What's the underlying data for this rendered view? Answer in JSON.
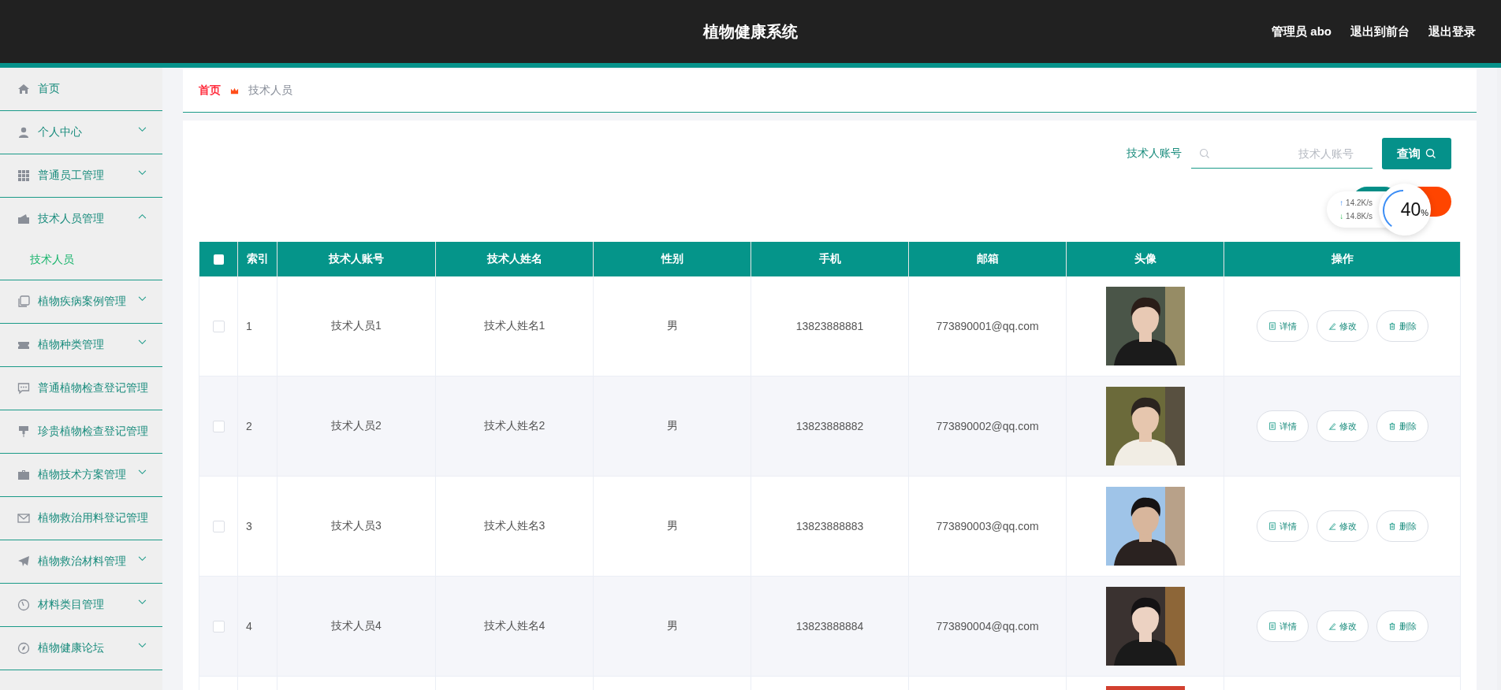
{
  "header": {
    "title": "植物健康系统",
    "links": [
      "管理员 abo",
      "退出到前台",
      "退出登录"
    ]
  },
  "sidebar": {
    "items": [
      {
        "label": "首页",
        "kind": "link"
      },
      {
        "label": "个人中心",
        "kind": "menu",
        "expanded": false
      },
      {
        "label": "普通员工管理",
        "kind": "menu",
        "expanded": false
      },
      {
        "label": "技术人员管理",
        "kind": "menu",
        "expanded": true,
        "children": [
          {
            "label": "技术人员",
            "selected": true
          }
        ]
      },
      {
        "label": "植物疾病案例管理",
        "kind": "menu",
        "expanded": false
      },
      {
        "label": "植物种类管理",
        "kind": "menu",
        "expanded": false
      },
      {
        "label": "普通植物检查登记管理",
        "kind": "link"
      },
      {
        "label": "珍贵植物检查登记管理",
        "kind": "link"
      },
      {
        "label": "植物技术方案管理",
        "kind": "menu",
        "expanded": false
      },
      {
        "label": "植物救治用料登记管理",
        "kind": "link"
      },
      {
        "label": "植物救治材料管理",
        "kind": "menu",
        "expanded": false
      },
      {
        "label": "材料类目管理",
        "kind": "menu",
        "expanded": false
      },
      {
        "label": "植物健康论坛",
        "kind": "menu",
        "expanded": false
      }
    ]
  },
  "breadcrumb": [
    "首页",
    "技术人员"
  ],
  "search": {
    "label": "技术人账号",
    "placeholder": "技术人账号",
    "button": "查询"
  },
  "speed_widget": {
    "upload_arrow": "↑",
    "upload": "14.2K/s",
    "download_arrow": "↓",
    "download": "14.8K/s",
    "percent": "40",
    "unit": "%"
  },
  "table": {
    "select_all_checked": false,
    "columns": [
      "索引",
      "技术人账号",
      "技术人姓名",
      "性别",
      "手机",
      "邮箱",
      "头像",
      "操作"
    ],
    "rows": [
      {
        "checked": false,
        "index": "1",
        "account": "技术人员1",
        "name": "技术人姓名1",
        "gender": "男",
        "phone": "13823888881",
        "email": "773890001@qq.com",
        "photo": {
          "kind": "picture"
        },
        "actions": [
          "详情",
          "修改",
          "删除"
        ]
      },
      {
        "checked": false,
        "index": "2",
        "account": "技术人员2",
        "name": "技术人姓名2",
        "gender": "男",
        "phone": "13823888882",
        "email": "773890002@qq.com",
        "photo": {
          "kind": "picture"
        },
        "actions": [
          "详情",
          "修改",
          "删除"
        ]
      },
      {
        "checked": false,
        "index": "3",
        "account": "技术人员3",
        "name": "技术人姓名3",
        "gender": "男",
        "phone": "13823888883",
        "email": "773890003@qq.com",
        "photo": {
          "kind": "picture"
        },
        "actions": [
          "详情",
          "修改",
          "删除"
        ]
      },
      {
        "checked": false,
        "index": "4",
        "account": "技术人员4",
        "name": "技术人姓名4",
        "gender": "男",
        "phone": "13823888884",
        "email": "773890004@qq.com",
        "photo": {
          "kind": "picture"
        },
        "actions": [
          "详情",
          "修改",
          "删除"
        ]
      }
    ]
  }
}
